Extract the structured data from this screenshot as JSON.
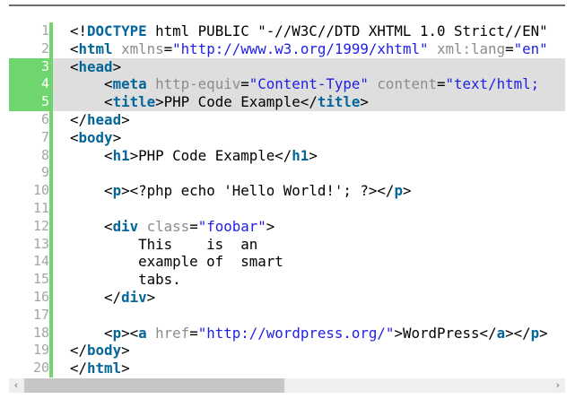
{
  "editor": {
    "highlighted_lines": [
      3,
      4,
      5
    ],
    "lines": [
      {
        "n": "1",
        "tokens": [
          [
            "txt",
            "<!"
          ],
          [
            "tag",
            "DOCTYPE"
          ],
          [
            "txt",
            " html PUBLIC \"-//W3C//DTD XHTML 1.0 Strict//EN\""
          ]
        ]
      },
      {
        "n": "2",
        "tokens": [
          [
            "txt",
            "<"
          ],
          [
            "tag",
            "html"
          ],
          [
            "attr",
            " xmlns"
          ],
          [
            "txt",
            "="
          ],
          [
            "str",
            "\"http://www.w3.org/1999/xhtml\""
          ],
          [
            "attr",
            " xml:lang"
          ],
          [
            "txt",
            "="
          ],
          [
            "str",
            "\"en\""
          ]
        ]
      },
      {
        "n": "3",
        "tokens": [
          [
            "txt",
            "<"
          ],
          [
            "tag",
            "head"
          ],
          [
            "txt",
            ">"
          ]
        ]
      },
      {
        "n": "4",
        "tokens": [
          [
            "txt",
            "    <"
          ],
          [
            "tag",
            "meta"
          ],
          [
            "attr",
            " http-equiv"
          ],
          [
            "txt",
            "="
          ],
          [
            "str",
            "\"Content-Type\""
          ],
          [
            "attr",
            " content"
          ],
          [
            "txt",
            "="
          ],
          [
            "str",
            "\"text/html;"
          ]
        ]
      },
      {
        "n": "5",
        "tokens": [
          [
            "txt",
            "    <"
          ],
          [
            "tag",
            "title"
          ],
          [
            "txt",
            ">PHP Code Example</"
          ],
          [
            "tag",
            "title"
          ],
          [
            "txt",
            ">"
          ]
        ]
      },
      {
        "n": "6",
        "tokens": [
          [
            "txt",
            "</"
          ],
          [
            "tag",
            "head"
          ],
          [
            "txt",
            ">"
          ]
        ]
      },
      {
        "n": "7",
        "tokens": [
          [
            "txt",
            "<"
          ],
          [
            "tag",
            "body"
          ],
          [
            "txt",
            ">"
          ]
        ]
      },
      {
        "n": "8",
        "tokens": [
          [
            "txt",
            "    <"
          ],
          [
            "tag",
            "h1"
          ],
          [
            "txt",
            ">PHP Code Example</"
          ],
          [
            "tag",
            "h1"
          ],
          [
            "txt",
            ">"
          ]
        ]
      },
      {
        "n": "9",
        "tokens": []
      },
      {
        "n": "10",
        "tokens": [
          [
            "txt",
            "    <"
          ],
          [
            "tag",
            "p"
          ],
          [
            "txt",
            ">"
          ],
          [
            "txt",
            "<?php echo 'Hello World!'; ?>"
          ],
          [
            "txt",
            "</"
          ],
          [
            "tag",
            "p"
          ],
          [
            "txt",
            ">"
          ]
        ]
      },
      {
        "n": "11",
        "tokens": []
      },
      {
        "n": "12",
        "tokens": [
          [
            "txt",
            "    <"
          ],
          [
            "tag",
            "div"
          ],
          [
            "attr",
            " class"
          ],
          [
            "txt",
            "="
          ],
          [
            "str",
            "\"foobar\""
          ],
          [
            "txt",
            ">"
          ]
        ]
      },
      {
        "n": "13",
        "tokens": [
          [
            "txt",
            "        This    is  an"
          ]
        ]
      },
      {
        "n": "14",
        "tokens": [
          [
            "txt",
            "        example of  smart"
          ]
        ]
      },
      {
        "n": "15",
        "tokens": [
          [
            "txt",
            "        tabs."
          ]
        ]
      },
      {
        "n": "16",
        "tokens": [
          [
            "txt",
            "    </"
          ],
          [
            "tag",
            "div"
          ],
          [
            "txt",
            ">"
          ]
        ]
      },
      {
        "n": "17",
        "tokens": []
      },
      {
        "n": "18",
        "tokens": [
          [
            "txt",
            "    <"
          ],
          [
            "tag",
            "p"
          ],
          [
            "txt",
            "><"
          ],
          [
            "tag",
            "a"
          ],
          [
            "attr",
            " href"
          ],
          [
            "txt",
            "="
          ],
          [
            "str",
            "\"http://wordpress.org/\""
          ],
          [
            "txt",
            ">WordPress</"
          ],
          [
            "tag",
            "a"
          ],
          [
            "txt",
            "></"
          ],
          [
            "tag",
            "p"
          ],
          [
            "txt",
            ">"
          ]
        ]
      },
      {
        "n": "19",
        "tokens": [
          [
            "txt",
            "</"
          ],
          [
            "tag",
            "body"
          ],
          [
            "txt",
            ">"
          ]
        ]
      },
      {
        "n": "20",
        "tokens": [
          [
            "txt",
            "</"
          ],
          [
            "tag",
            "html"
          ],
          [
            "txt",
            ">"
          ]
        ]
      }
    ]
  },
  "scrollbar": {
    "left_arrow": "‹",
    "right_arrow": "›",
    "position_fraction": 0
  }
}
